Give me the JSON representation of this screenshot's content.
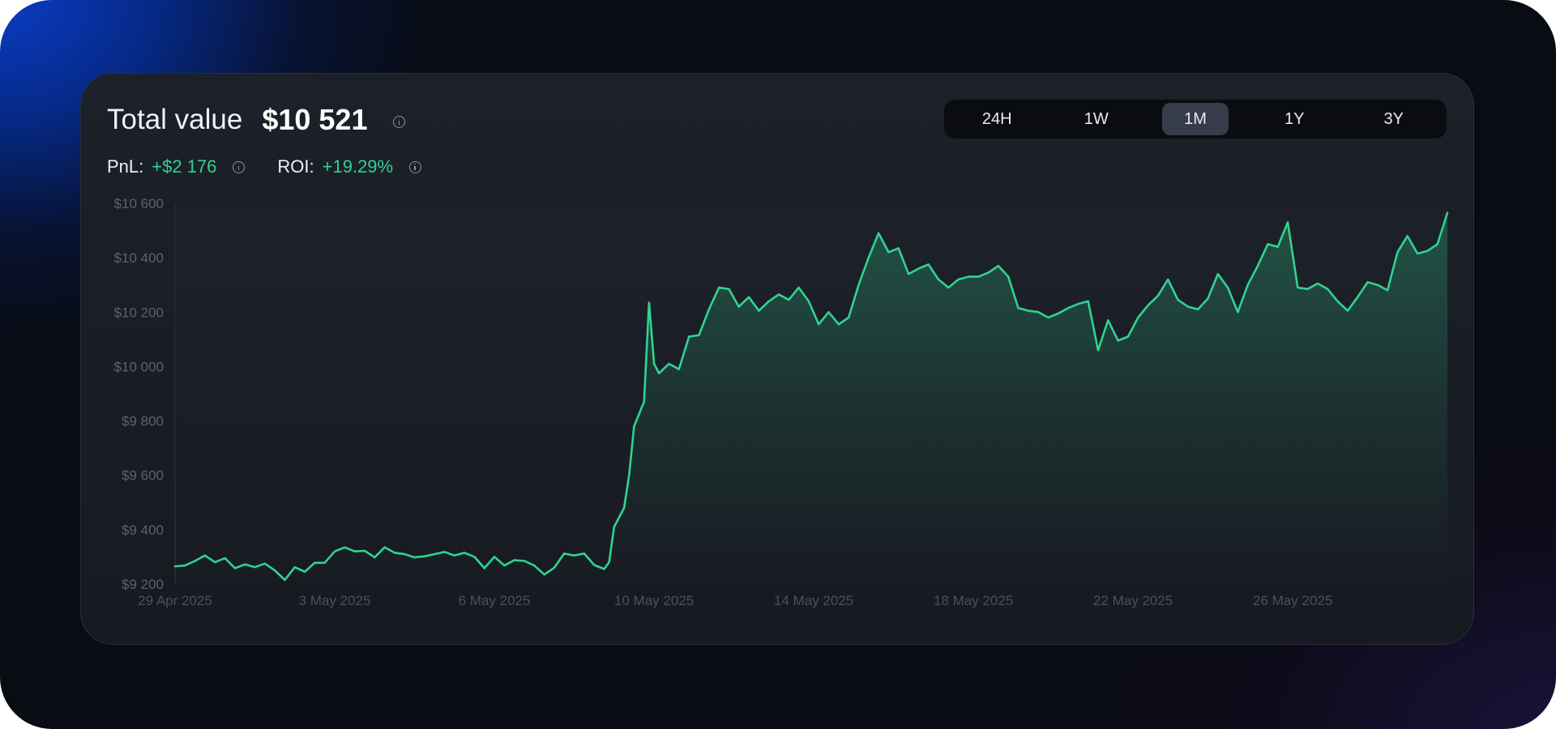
{
  "header": {
    "title": "Total value",
    "value": "$10 521"
  },
  "stats": {
    "pnl_label": "PnL:",
    "pnl_value": "+$2 176",
    "roi_label": "ROI:",
    "roi_value": "+19.29%"
  },
  "tabs": [
    {
      "label": "24H",
      "active": false
    },
    {
      "label": "1W",
      "active": false
    },
    {
      "label": "1M",
      "active": true
    },
    {
      "label": "1Y",
      "active": false
    },
    {
      "label": "3Y",
      "active": false
    }
  ],
  "colors": {
    "line": "#2fd48f",
    "positive": "#2fd48f"
  },
  "chart_data": {
    "type": "area",
    "ylim": [
      9200,
      10600
    ],
    "y_ticks": [
      9200,
      9400,
      9600,
      9800,
      10000,
      10200,
      10400,
      10600
    ],
    "y_tick_labels": [
      "$9 200",
      "$9 400",
      "$9 600",
      "$9 800",
      "$10 000",
      "$10 200",
      "$10 400",
      "$10 600"
    ],
    "x_range": [
      "2025-04-29",
      "2025-05-30"
    ],
    "x_ticks": [
      "29 Apr 2025",
      "3 May 2025",
      "6 May 2025",
      "10 May 2025",
      "14 May 2025",
      "18 May 2025",
      "22 May 2025",
      "26 May 2025"
    ],
    "x_tick_dates": [
      "2025-04-29",
      "2025-05-03",
      "2025-05-07",
      "2025-05-11",
      "2025-05-15",
      "2025-05-19",
      "2025-05-23",
      "2025-05-27"
    ],
    "grid": false,
    "series": [
      {
        "points": [
          [
            "2025-04-29T00:00",
            9265
          ],
          [
            "2025-04-29T06:00",
            9268
          ],
          [
            "2025-04-29T12:00",
            9285
          ],
          [
            "2025-04-29T18:00",
            9305
          ],
          [
            "2025-04-30T00:00",
            9280
          ],
          [
            "2025-04-30T06:00",
            9295
          ],
          [
            "2025-04-30T12:00",
            9258
          ],
          [
            "2025-04-30T18:00",
            9272
          ],
          [
            "2025-05-01T00:00",
            9262
          ],
          [
            "2025-05-01T06:00",
            9275
          ],
          [
            "2025-05-01T12:00",
            9250
          ],
          [
            "2025-05-01T18:00",
            9215
          ],
          [
            "2025-05-02T00:00",
            9262
          ],
          [
            "2025-05-02T06:00",
            9245
          ],
          [
            "2025-05-02T12:00",
            9278
          ],
          [
            "2025-05-02T18:00",
            9278
          ],
          [
            "2025-05-03T00:00",
            9320
          ],
          [
            "2025-05-03T06:00",
            9335
          ],
          [
            "2025-05-03T12:00",
            9320
          ],
          [
            "2025-05-03T18:00",
            9322
          ],
          [
            "2025-05-04T00:00",
            9298
          ],
          [
            "2025-05-04T06:00",
            9335
          ],
          [
            "2025-05-04T12:00",
            9315
          ],
          [
            "2025-05-04T18:00",
            9310
          ],
          [
            "2025-05-05T00:00",
            9298
          ],
          [
            "2025-05-05T06:00",
            9302
          ],
          [
            "2025-05-05T12:00",
            9310
          ],
          [
            "2025-05-05T18:00",
            9318
          ],
          [
            "2025-05-06T00:00",
            9305
          ],
          [
            "2025-05-06T06:00",
            9315
          ],
          [
            "2025-05-06T12:00",
            9300
          ],
          [
            "2025-05-06T18:00",
            9258
          ],
          [
            "2025-05-07T00:00",
            9300
          ],
          [
            "2025-05-07T06:00",
            9268
          ],
          [
            "2025-05-07T12:00",
            9288
          ],
          [
            "2025-05-07T18:00",
            9285
          ],
          [
            "2025-05-08T00:00",
            9268
          ],
          [
            "2025-05-08T06:00",
            9235
          ],
          [
            "2025-05-08T12:00",
            9260
          ],
          [
            "2025-05-08T18:00",
            9312
          ],
          [
            "2025-05-09T00:00",
            9305
          ],
          [
            "2025-05-09T06:00",
            9312
          ],
          [
            "2025-05-09T12:00",
            9270
          ],
          [
            "2025-05-09T18:00",
            9255
          ],
          [
            "2025-05-09T21:00",
            9280
          ],
          [
            "2025-05-10T00:00",
            9410
          ],
          [
            "2025-05-10T06:00",
            9480
          ],
          [
            "2025-05-10T09:00",
            9600
          ],
          [
            "2025-05-10T12:00",
            9780
          ],
          [
            "2025-05-10T18:00",
            9870
          ],
          [
            "2025-05-10T21:00",
            10235
          ],
          [
            "2025-05-11T00:00",
            10010
          ],
          [
            "2025-05-11T03:00",
            9975
          ],
          [
            "2025-05-11T09:00",
            10010
          ],
          [
            "2025-05-11T15:00",
            9990
          ],
          [
            "2025-05-11T21:00",
            10110
          ],
          [
            "2025-05-12T03:00",
            10115
          ],
          [
            "2025-05-12T09:00",
            10210
          ],
          [
            "2025-05-12T15:00",
            10290
          ],
          [
            "2025-05-12T21:00",
            10285
          ],
          [
            "2025-05-13T03:00",
            10220
          ],
          [
            "2025-05-13T09:00",
            10255
          ],
          [
            "2025-05-13T15:00",
            10205
          ],
          [
            "2025-05-13T21:00",
            10240
          ],
          [
            "2025-05-14T03:00",
            10265
          ],
          [
            "2025-05-14T09:00",
            10245
          ],
          [
            "2025-05-14T15:00",
            10290
          ],
          [
            "2025-05-14T21:00",
            10240
          ],
          [
            "2025-05-15T03:00",
            10155
          ],
          [
            "2025-05-15T09:00",
            10200
          ],
          [
            "2025-05-15T15:00",
            10155
          ],
          [
            "2025-05-15T21:00",
            10180
          ],
          [
            "2025-05-16T03:00",
            10300
          ],
          [
            "2025-05-16T09:00",
            10400
          ],
          [
            "2025-05-16T15:00",
            10490
          ],
          [
            "2025-05-16T21:00",
            10420
          ],
          [
            "2025-05-17T03:00",
            10435
          ],
          [
            "2025-05-17T09:00",
            10340
          ],
          [
            "2025-05-17T15:00",
            10360
          ],
          [
            "2025-05-17T21:00",
            10375
          ],
          [
            "2025-05-18T03:00",
            10320
          ],
          [
            "2025-05-18T09:00",
            10290
          ],
          [
            "2025-05-18T15:00",
            10320
          ],
          [
            "2025-05-18T21:00",
            10330
          ],
          [
            "2025-05-19T03:00",
            10330
          ],
          [
            "2025-05-19T09:00",
            10345
          ],
          [
            "2025-05-19T15:00",
            10370
          ],
          [
            "2025-05-19T21:00",
            10330
          ],
          [
            "2025-05-20T03:00",
            10215
          ],
          [
            "2025-05-20T09:00",
            10205
          ],
          [
            "2025-05-20T15:00",
            10200
          ],
          [
            "2025-05-20T21:00",
            10180
          ],
          [
            "2025-05-21T03:00",
            10195
          ],
          [
            "2025-05-21T09:00",
            10215
          ],
          [
            "2025-05-21T15:00",
            10230
          ],
          [
            "2025-05-21T21:00",
            10240
          ],
          [
            "2025-05-22T03:00",
            10060
          ],
          [
            "2025-05-22T09:00",
            10170
          ],
          [
            "2025-05-22T15:00",
            10095
          ],
          [
            "2025-05-22T21:00",
            10110
          ],
          [
            "2025-05-23T03:00",
            10180
          ],
          [
            "2025-05-23T09:00",
            10225
          ],
          [
            "2025-05-23T15:00",
            10260
          ],
          [
            "2025-05-23T21:00",
            10320
          ],
          [
            "2025-05-24T03:00",
            10245
          ],
          [
            "2025-05-24T09:00",
            10220
          ],
          [
            "2025-05-24T15:00",
            10210
          ],
          [
            "2025-05-24T21:00",
            10250
          ],
          [
            "2025-05-25T03:00",
            10340
          ],
          [
            "2025-05-25T09:00",
            10290
          ],
          [
            "2025-05-25T15:00",
            10200
          ],
          [
            "2025-05-25T21:00",
            10300
          ],
          [
            "2025-05-26T03:00",
            10370
          ],
          [
            "2025-05-26T09:00",
            10450
          ],
          [
            "2025-05-26T15:00",
            10440
          ],
          [
            "2025-05-26T21:00",
            10530
          ],
          [
            "2025-05-27T03:00",
            10290
          ],
          [
            "2025-05-27T09:00",
            10285
          ],
          [
            "2025-05-27T15:00",
            10305
          ],
          [
            "2025-05-27T21:00",
            10285
          ],
          [
            "2025-05-28T03:00",
            10240
          ],
          [
            "2025-05-28T09:00",
            10205
          ],
          [
            "2025-05-28T15:00",
            10255
          ],
          [
            "2025-05-28T21:00",
            10310
          ],
          [
            "2025-05-29T03:00",
            10300
          ],
          [
            "2025-05-29T09:00",
            10280
          ],
          [
            "2025-05-29T15:00",
            10420
          ],
          [
            "2025-05-29T21:00",
            10480
          ],
          [
            "2025-05-30T03:00",
            10415
          ],
          [
            "2025-05-30T09:00",
            10425
          ],
          [
            "2025-05-30T15:00",
            10450
          ],
          [
            "2025-05-30T21:00",
            10565
          ]
        ]
      }
    ]
  }
}
